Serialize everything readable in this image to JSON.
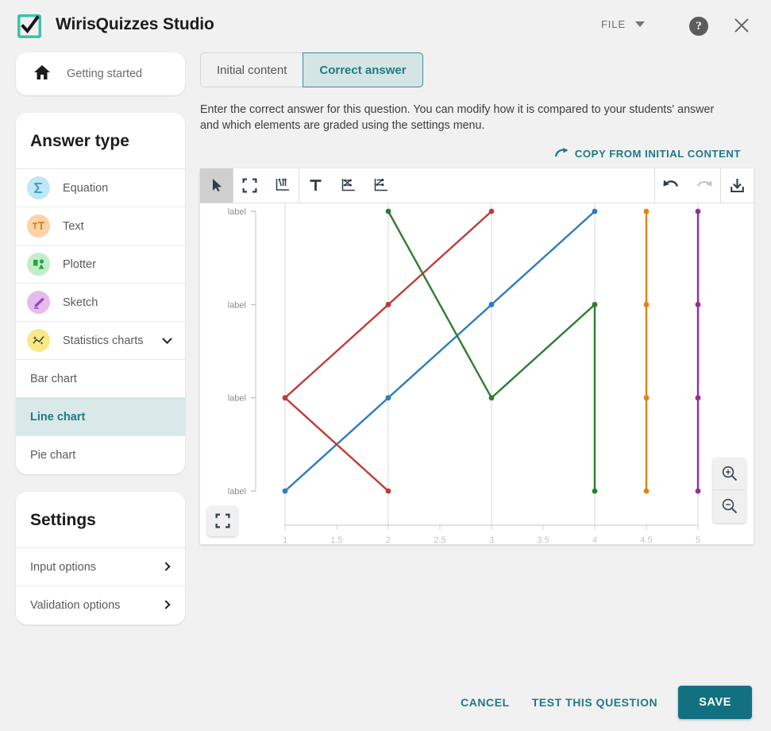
{
  "header": {
    "app_title": "WirisQuizzes Studio",
    "logo_icon": "checkbox-check-icon",
    "file_menu_label": "FILE",
    "file_caret_icon": "caret-down-icon",
    "help_label": "?",
    "help_icon": "help-circle-icon",
    "close_icon": "close-icon",
    "accent_color": "#127180",
    "logo_color": "#3fbfa8"
  },
  "sidebar": {
    "getting_started": {
      "label": "Getting started",
      "icon": "home-icon"
    },
    "answer_type": {
      "title": "Answer type",
      "items": [
        {
          "label": "Equation",
          "icon": "sigma-icon",
          "bubble_bg": "#bfe7f5",
          "glyph": "Σ",
          "glyph_color": "#2f9dc4"
        },
        {
          "label": "Text",
          "icon": "text-format-icon",
          "bubble_bg": "#fbd3a8",
          "glyph": "тT",
          "glyph_color": "#e8821e"
        },
        {
          "label": "Plotter",
          "icon": "plotter-shapes-icon",
          "bubble_bg": "#c3ecc9",
          "glyph": "",
          "glyph_color": "#1faa3c"
        },
        {
          "label": "Sketch",
          "icon": "pencil-icon",
          "bubble_bg": "#e3bdec",
          "glyph": "",
          "glyph_color": "#9b43c9"
        },
        {
          "label": "Statistics charts",
          "icon": "sparkle-chart-icon",
          "bubble_bg": "#f7e98a",
          "glyph": "",
          "glyph_color": "#4a4a2a",
          "expandable": true,
          "expand_icon": "chevron-down-icon"
        }
      ],
      "sub_items": [
        {
          "label": "Bar chart",
          "active": false
        },
        {
          "label": "Line chart",
          "active": true
        },
        {
          "label": "Pie chart",
          "active": false
        }
      ]
    },
    "settings": {
      "title": "Settings",
      "items": [
        {
          "label": "Input options",
          "icon": "chevron-right-icon"
        },
        {
          "label": "Validation options",
          "icon": "chevron-right-icon"
        }
      ]
    }
  },
  "main": {
    "tabs": [
      {
        "label": "Initial content",
        "active": false
      },
      {
        "label": "Correct answer",
        "active": true
      }
    ],
    "description": "Enter the correct answer for this question. You can modify how it is compared to your students' answer and which elements are graded using the settings menu.",
    "copy_link": {
      "label": "COPY FROM INITIAL CONTENT",
      "icon": "redo-arrow-icon"
    }
  },
  "editor": {
    "toolbar": [
      {
        "name": "select-tool",
        "icon": "cursor-arrow-icon",
        "selected": true,
        "disabled": false
      },
      {
        "name": "fit-screen-tool",
        "icon": "expand-frame-icon",
        "selected": false,
        "disabled": false
      },
      {
        "name": "axis-labels-tool",
        "icon": "axis-labels-icon",
        "selected": false,
        "disabled": false
      },
      {
        "name": "text-tool",
        "icon": "text-T-icon",
        "selected": false,
        "disabled": false
      },
      {
        "name": "line-series-tool",
        "icon": "line-series-icon",
        "selected": false,
        "disabled": false
      },
      {
        "name": "line-series-alt-tool",
        "icon": "line-series-alt-icon",
        "selected": false,
        "disabled": false
      },
      {
        "name": "undo-tool",
        "icon": "undo-arrow-icon",
        "selected": false,
        "disabled": false
      },
      {
        "name": "redo-tool",
        "icon": "redo-arrow-icon",
        "selected": false,
        "disabled": true
      },
      {
        "name": "download-tool",
        "icon": "download-icon",
        "selected": false,
        "disabled": false
      }
    ],
    "fullscreen_icon": "expand-frame-icon",
    "zoom_in_icon": "magnifier-plus-icon",
    "zoom_out_icon": "magnifier-minus-icon"
  },
  "chart_data": {
    "type": "line",
    "title": "",
    "xlabel": "",
    "ylabel": "",
    "xlim": [
      1,
      5
    ],
    "ylim": [
      1,
      4
    ],
    "grid": true,
    "legend": "none",
    "x_ticks": [
      "1",
      "1.5",
      "2",
      "2.5",
      "3",
      "3.5",
      "4",
      "4.5",
      "5"
    ],
    "x_tick_values": [
      1,
      1.5,
      2,
      2.5,
      3,
      3.5,
      4,
      4.5,
      5
    ],
    "y_ticks": [
      "label",
      "label",
      "label",
      "label"
    ],
    "y_tick_values": [
      1,
      2,
      3,
      4
    ],
    "series": [
      {
        "name": "blue-series",
        "color": "#2d7cc1",
        "points": [
          [
            1,
            1
          ],
          [
            2,
            2
          ],
          [
            3,
            3
          ],
          [
            4,
            4
          ]
        ]
      },
      {
        "name": "red-series",
        "color": "#bf3b36",
        "points": [
          [
            2,
            1
          ],
          [
            1,
            2
          ],
          [
            2,
            3
          ],
          [
            3,
            4
          ]
        ]
      },
      {
        "name": "green-series",
        "color": "#2f7d32",
        "points": [
          [
            2,
            4
          ],
          [
            3,
            2
          ],
          [
            4,
            3
          ],
          [
            4,
            1
          ]
        ]
      },
      {
        "name": "orange-series",
        "color": "#e08214",
        "points": [
          [
            4.5,
            4
          ],
          [
            4.5,
            3
          ],
          [
            4.5,
            2
          ],
          [
            4.5,
            1
          ]
        ]
      },
      {
        "name": "purple-series",
        "color": "#9b2a9b",
        "points": [
          [
            5,
            4
          ],
          [
            5,
            3
          ],
          [
            5,
            2
          ],
          [
            5,
            1
          ]
        ]
      }
    ]
  },
  "footer": {
    "cancel_label": "CANCEL",
    "test_label": "TEST THIS QUESTION",
    "save_label": "SAVE"
  }
}
